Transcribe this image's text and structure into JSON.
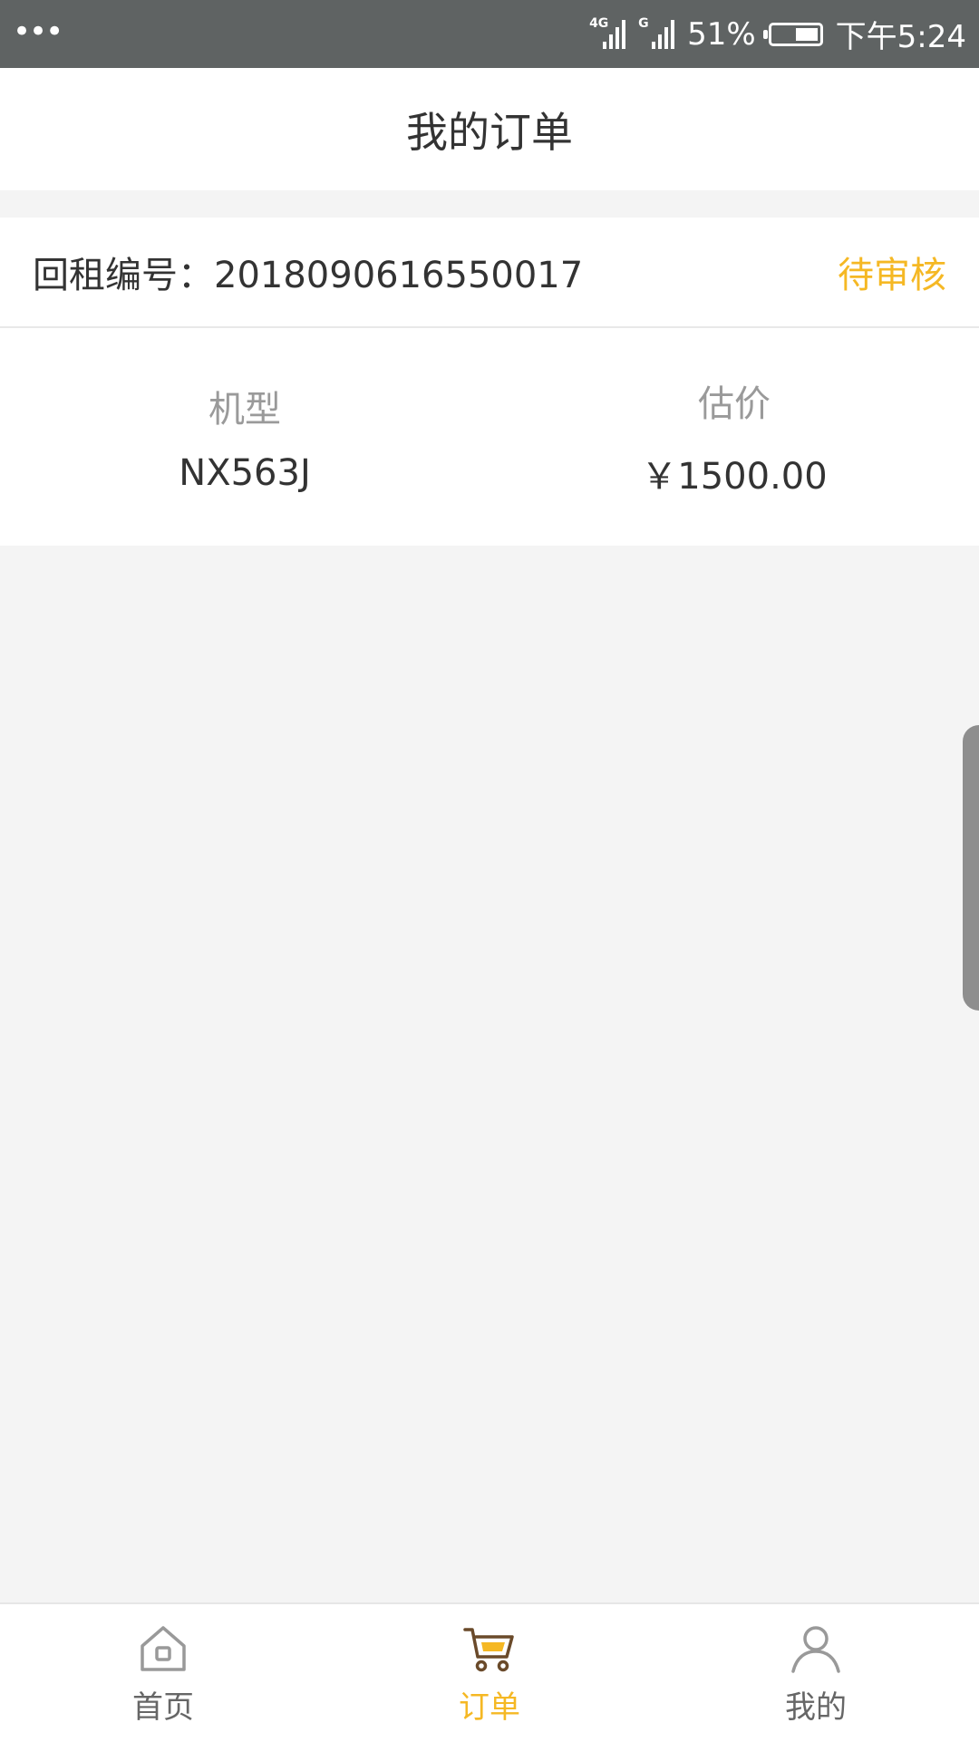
{
  "status_bar": {
    "menu_dots": "•••",
    "signal1_tag": "4G",
    "signal2_tag": "G",
    "battery_percent": "51%",
    "battery_level_fraction": 0.51,
    "time": "下午5:24"
  },
  "header": {
    "title": "我的订单"
  },
  "order": {
    "number_label": "回租编号：",
    "number_value": "2018090616550017",
    "status": "待审核",
    "status_color": "#f5b824",
    "model_label": "机型",
    "model_value": "NX563J",
    "price_label": "估价",
    "price_value": "￥1500.00"
  },
  "bottom_nav": {
    "items": [
      {
        "label": "首页",
        "icon": "home-icon",
        "active": false
      },
      {
        "label": "订单",
        "icon": "cart-icon",
        "active": true
      },
      {
        "label": "我的",
        "icon": "user-icon",
        "active": false
      }
    ],
    "active_color": "#f5b824"
  }
}
